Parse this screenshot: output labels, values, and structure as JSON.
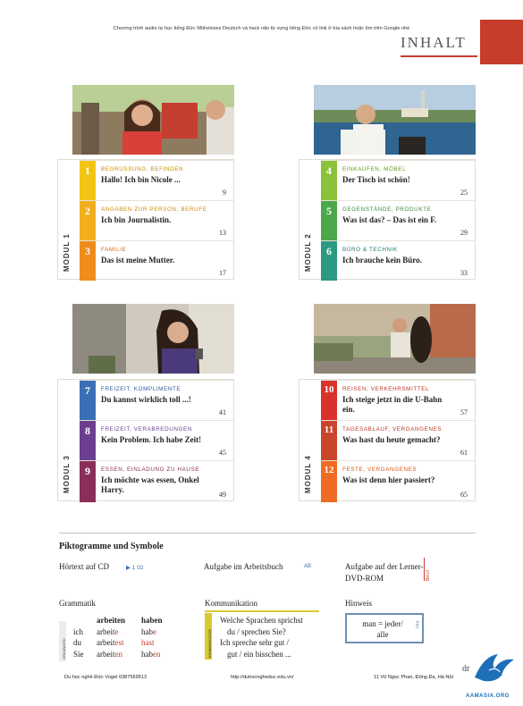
{
  "notice": "Chương trình audio tự học tiếng Đức Mûheloses Deutsch và hack não từ vựng tiếng Đức có link ở bìa sách hoặc tìm trên Google nhé",
  "title": "INHALT",
  "modules": [
    {
      "label": "MODUL 1",
      "lessons": [
        {
          "num": "1",
          "topic": "Begrüssung, Befinden",
          "title": "Hallo! Ich bin Nicole ...",
          "page": "9",
          "color": "#f2c515"
        },
        {
          "num": "2",
          "topic": "Angaben zur Person, Berufe",
          "title": "Ich bin Journalistin.",
          "page": "13",
          "color": "#f2ae1d"
        },
        {
          "num": "3",
          "topic": "Familie",
          "title": "Das ist meine Mutter.",
          "page": "17",
          "color": "#ef8c1c"
        }
      ]
    },
    {
      "label": "MODUL 2",
      "lessons": [
        {
          "num": "4",
          "topic": "Einkaufen, Möbel",
          "title": "Der Tisch ist schön!",
          "page": "25",
          "color": "#8cc13a"
        },
        {
          "num": "5",
          "topic": "Gegenstände, Produkte",
          "title": "Was ist das? – Das ist ein F.",
          "page": "29",
          "color": "#4ba84a"
        },
        {
          "num": "6",
          "topic": "Büro & Technik",
          "title": "Ich brauche kein Büro.",
          "page": "33",
          "color": "#2a9a82"
        }
      ]
    },
    {
      "label": "MODUL 3",
      "lessons": [
        {
          "num": "7",
          "topic": "Freizeit, Komplimente",
          "title": "Du kannst wirklich toll ...!",
          "page": "41",
          "color": "#3b6fb5"
        },
        {
          "num": "8",
          "topic": "Freizeit, Verabredungen",
          "title": "Kein Problem. Ich habe Zeit!",
          "page": "45",
          "color": "#6b3e8f"
        },
        {
          "num": "9",
          "topic": "Essen, Einladung zu Hause",
          "title": "Ich möchte was essen, Onkel Harry.",
          "page": "49",
          "color": "#8a2f5a"
        }
      ]
    },
    {
      "label": "MODUL 4",
      "lessons": [
        {
          "num": "10",
          "topic": "Reisen, Verkehrsmittel",
          "title": "Ich steige jetzt in die U-Bahn ein.",
          "page": "57",
          "color": "#d9322a"
        },
        {
          "num": "11",
          "topic": "Tagesablauf, Vergangenes",
          "title": "Was hast du heute gemacht?",
          "page": "61",
          "color": "#c9452c"
        },
        {
          "num": "12",
          "topic": "Feste, Vergangenes",
          "title": "Was ist denn hier passiert?",
          "page": "65",
          "color": "#ef6a22"
        }
      ]
    }
  ],
  "symbols": {
    "heading": "Piktogramme und Symbole",
    "hoertext": "Hörtext auf CD",
    "hoertext_track": "▶ 1 02",
    "aufgabe_ab": "Aufgabe im Arbeitsbuch",
    "ab_tag": "AB",
    "aufgabe_dvd": "Aufgabe auf der Lerner-DVD-ROM",
    "dvd_tag": "Beruf",
    "grammatik": "Grammatik",
    "grammatik_tab": "GRAMMATIK",
    "grammar_rows": [
      [
        "",
        "arbeiten",
        "haben"
      ],
      [
        "ich",
        "arbeite",
        "habe"
      ],
      [
        "du",
        "arbeitest",
        "hast"
      ],
      [
        "Sie",
        "arbeiten",
        "haben"
      ]
    ],
    "kommunikation": "Kommunikation",
    "komm_tab": "KOMMUNIKATION",
    "komm_lines": [
      "Welche Sprachen sprichst",
      "du / sprechen Sie?",
      "Ich spreche sehr gut /",
      "gut / ein bisschen ..."
    ],
    "hinweis": "Hinweis",
    "hinweis_text": "man = jeder/ alle",
    "hinweis_tag": "Info"
  },
  "footer": {
    "left": "Du học nghề Đức Vogel 0387569513",
    "mid": "http://duhocngheduc.edu.vn/",
    "right": "11 Vũ Ngọc Phan, Đống Đa, Hà Nội",
    "logo_text": "AAMASIA.ORG",
    "corner": "dr"
  },
  "colors": {
    "accent": "#c63d2c"
  }
}
